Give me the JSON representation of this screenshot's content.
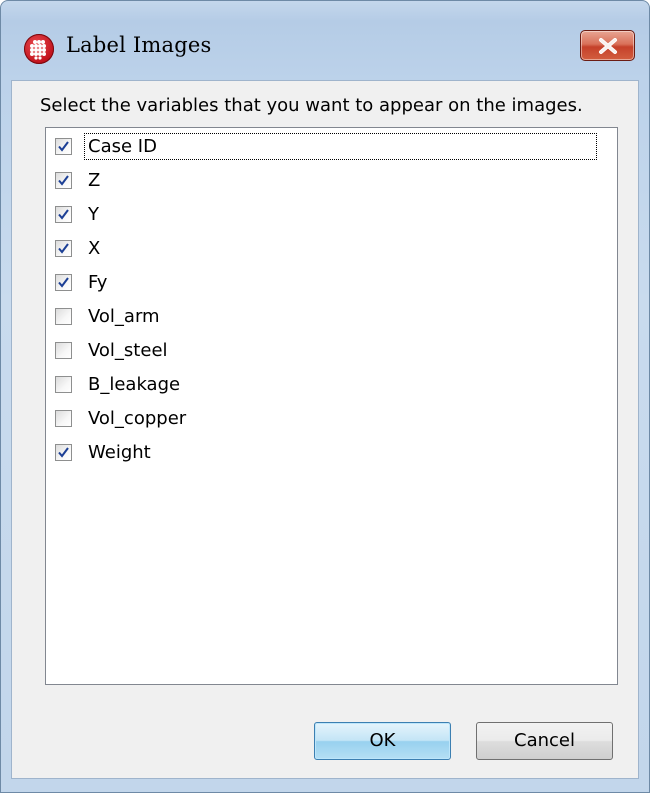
{
  "window": {
    "title": "Label Images",
    "icon": "app-grid-icon",
    "close_icon": "close-icon"
  },
  "dialog": {
    "instructions": "Select the variables that you want to appear on the images.",
    "items": [
      {
        "label": "Case ID",
        "checked": true
      },
      {
        "label": "Z",
        "checked": true
      },
      {
        "label": "Y",
        "checked": true
      },
      {
        "label": "X",
        "checked": true
      },
      {
        "label": "Fy",
        "checked": true
      },
      {
        "label": "Vol_arm",
        "checked": false
      },
      {
        "label": "Vol_steel",
        "checked": false
      },
      {
        "label": "B_leakage",
        "checked": false
      },
      {
        "label": "Vol_copper",
        "checked": false
      },
      {
        "label": "Weight",
        "checked": true
      }
    ]
  },
  "buttons": {
    "ok_label": "OK",
    "cancel_label": "Cancel"
  },
  "colors": {
    "accent": "#3c7fb1",
    "close_red": "#c5412a",
    "check": "#1c3f95"
  }
}
